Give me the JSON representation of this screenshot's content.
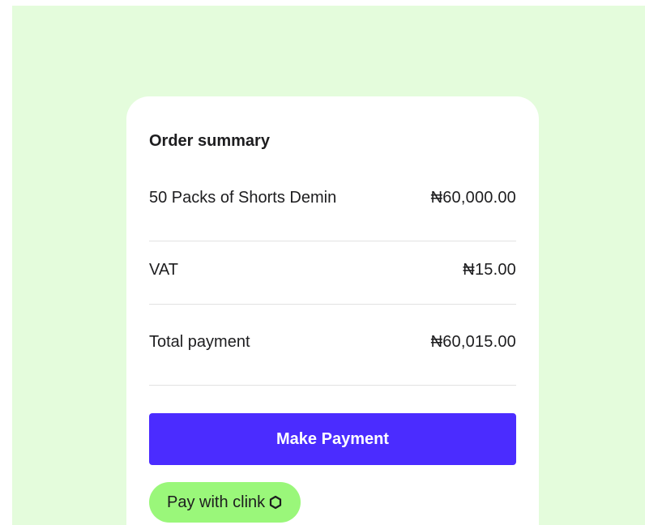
{
  "order_summary": {
    "title": "Order summary",
    "items": [
      {
        "label": "50 Packs of Shorts Demin",
        "value": "₦60,000.00"
      },
      {
        "label": "VAT",
        "value": "₦15.00"
      },
      {
        "label": "Total payment",
        "value": "₦60,015.00"
      }
    ]
  },
  "actions": {
    "make_payment_label": "Make Payment",
    "pay_with_clink_label": "Pay with clink",
    "clink_icon": "clink-logo-icon"
  },
  "colors": {
    "background": "#e4fcdc",
    "primary_button": "#4b2cff",
    "clink_button": "#9af77a"
  }
}
